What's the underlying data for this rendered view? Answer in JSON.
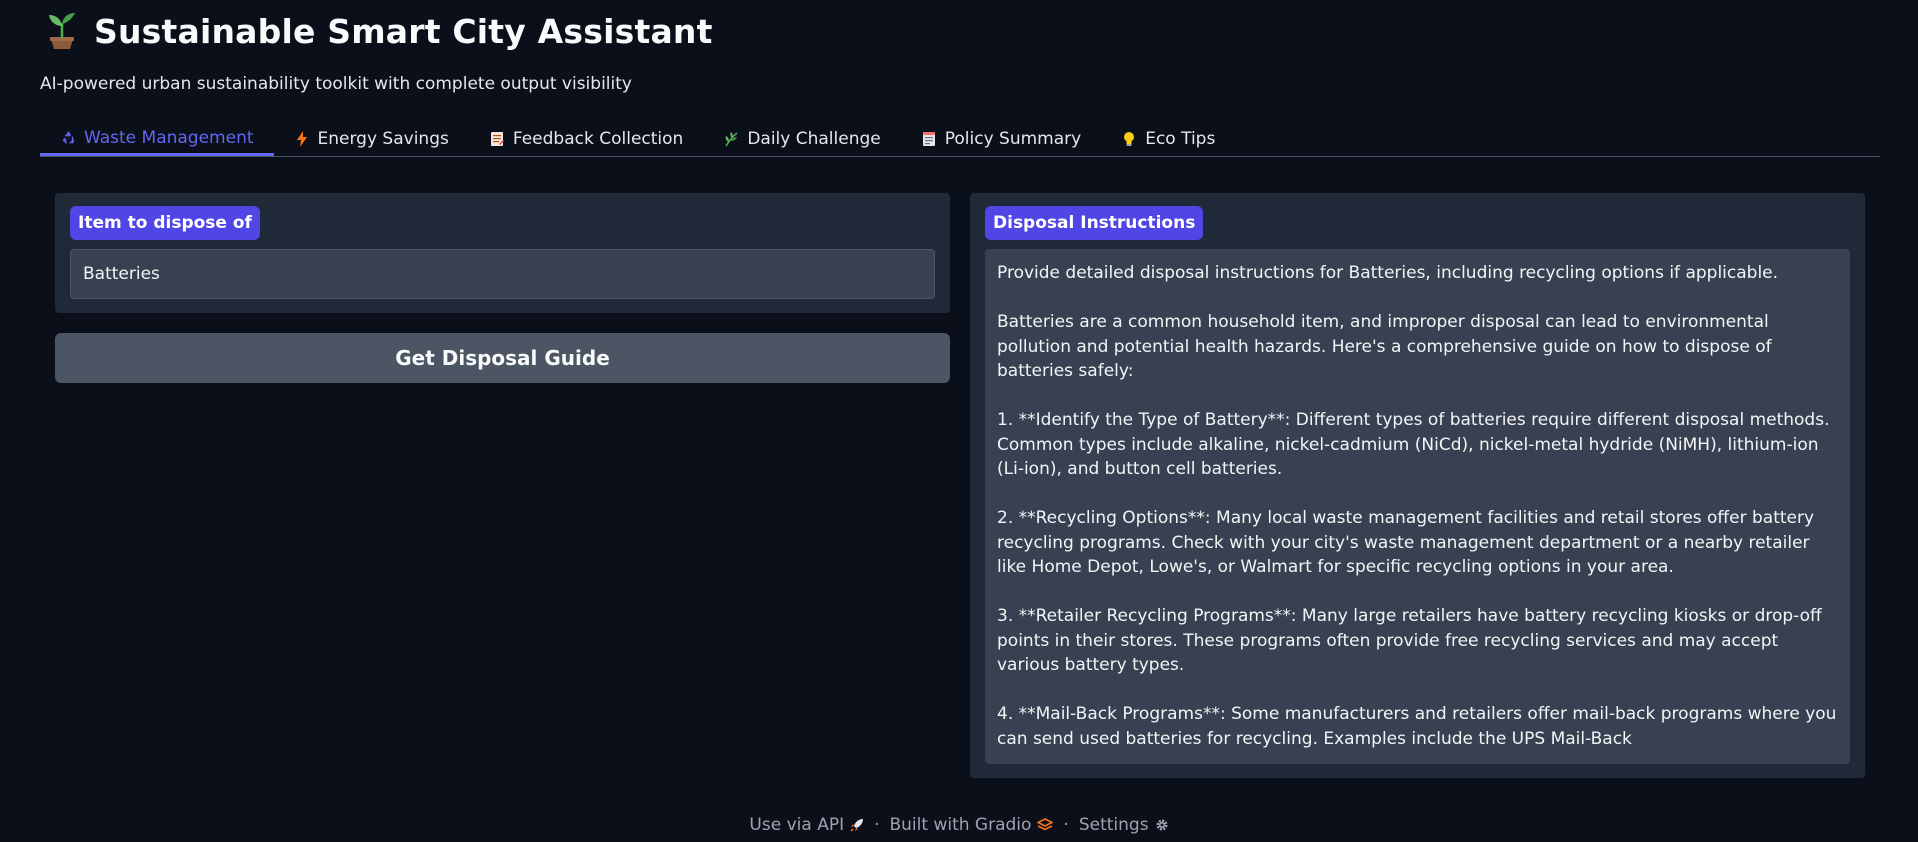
{
  "header": {
    "title": "Sustainable Smart City Assistant",
    "title_icon": "seedling-icon",
    "subtitle": "AI-powered urban sustainability toolkit with complete output visibility"
  },
  "tabs": [
    {
      "label": "Waste Management",
      "icon": "recycle-icon",
      "active": true
    },
    {
      "label": "Energy Savings",
      "icon": "lightning-icon",
      "active": false
    },
    {
      "label": "Feedback Collection",
      "icon": "memo-icon",
      "active": false
    },
    {
      "label": "Daily Challenge",
      "icon": "herb-icon",
      "active": false
    },
    {
      "label": "Policy Summary",
      "icon": "document-icon",
      "active": false
    },
    {
      "label": "Eco Tips",
      "icon": "lightbulb-icon",
      "active": false
    }
  ],
  "waste": {
    "input_label": "Item to dispose of",
    "input_value": "Batteries",
    "button_label": "Get Disposal Guide",
    "output_label": "Disposal Instructions",
    "output_text": "Provide detailed disposal instructions for Batteries, including recycling options if applicable.\n\nBatteries are a common household item, and improper disposal can lead to environmental pollution and potential health hazards. Here's a comprehensive guide on how to dispose of batteries safely:\n\n1. **Identify the Type of Battery**: Different types of batteries require different disposal methods. Common types include alkaline, nickel-cadmium (NiCd), nickel-metal hydride (NiMH), lithium-ion (Li-ion), and button cell batteries.\n\n2. **Recycling Options**: Many local waste management facilities and retail stores offer battery recycling programs. Check with your city's waste management department or a nearby retailer like Home Depot, Lowe's, or Walmart for specific recycling options in your area.\n\n3. **Retailer Recycling Programs**: Many large retailers have battery recycling kiosks or drop-off points in their stores. These programs often provide free recycling services and may accept various battery types.\n\n4. **Mail-Back Programs**: Some manufacturers and retailers offer mail-back programs where you can send used batteries for recycling. Examples include the UPS Mail-Back"
  },
  "footer": {
    "api_label": "Use via API",
    "built_label": "Built with Gradio",
    "settings_label": "Settings",
    "separator": "·"
  },
  "colors": {
    "background": "#0b0f19",
    "panel": "#1f2937",
    "input": "#374151",
    "accent": "#6366f1",
    "badge": "#4f46e5",
    "button": "#4b5563"
  }
}
